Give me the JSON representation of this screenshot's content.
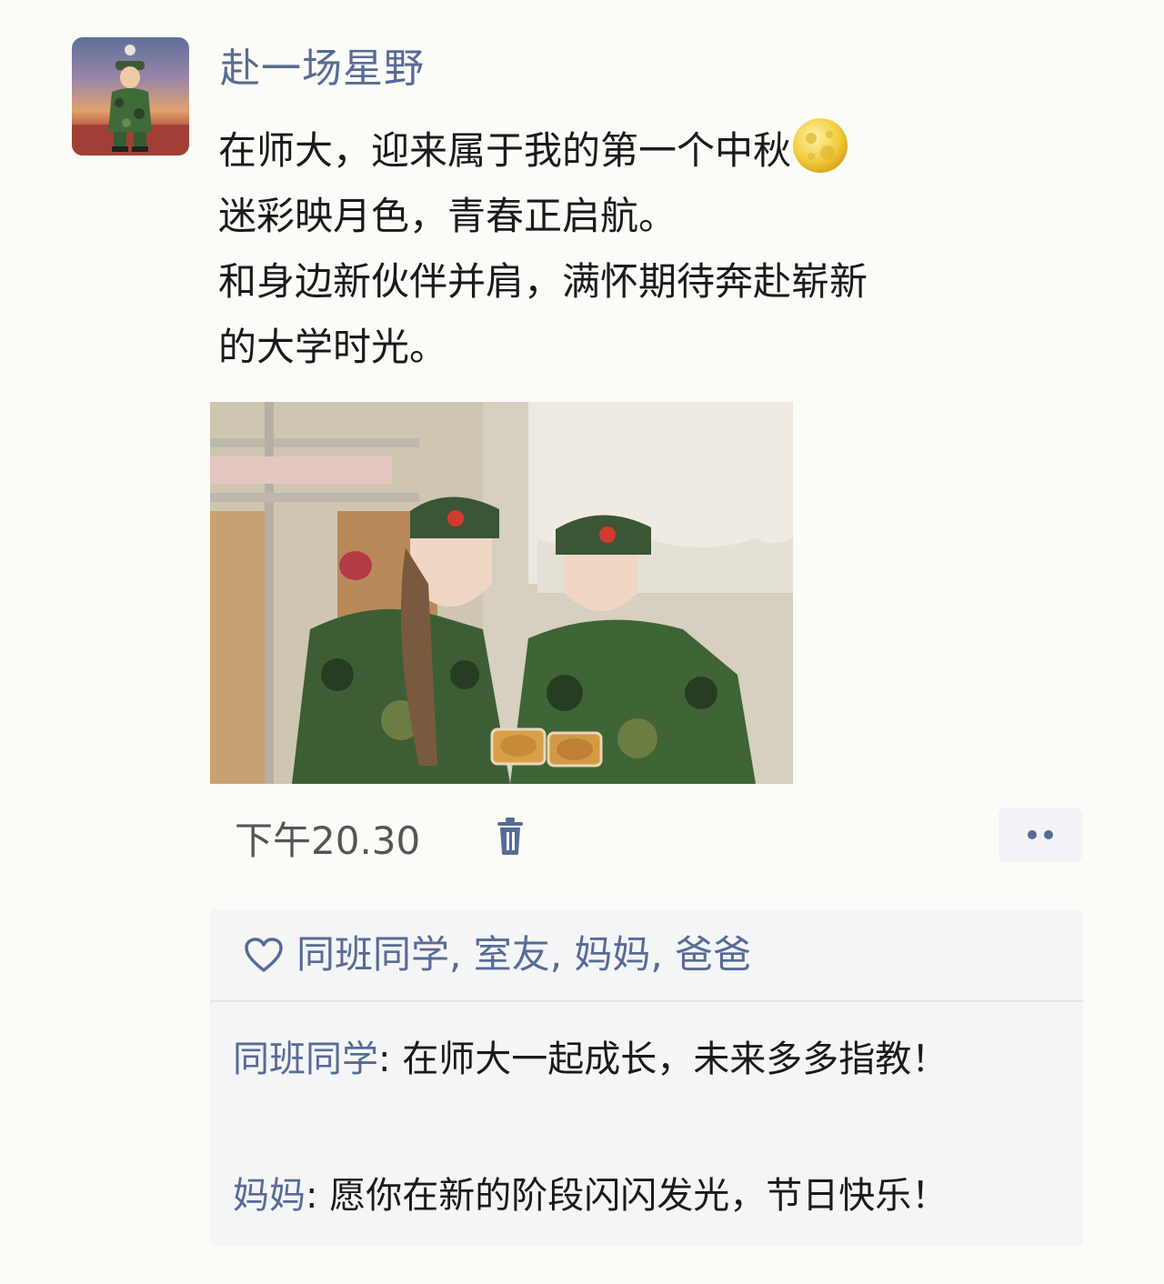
{
  "post": {
    "author": "赴一场星野",
    "text_lines": [
      "在师大，迎来属于我的第一个中秋",
      "迷彩映月色，青春正启航。",
      "和身边新伙伴并肩，满怀期待奔赴崭新",
      "的大学时光。"
    ],
    "emoji": "moon-icon",
    "time": "下午20.30"
  },
  "likes": {
    "names": "同班同学, 室友, 妈妈, 爸爸"
  },
  "comments": [
    {
      "author": "同班同学",
      "separator": ": ",
      "text": "在师大一起成长，未来多多指教！"
    },
    {
      "author": "妈妈",
      "separator": ": ",
      "text": "愿你在新的阶段闪闪发光，节日快乐！"
    }
  ],
  "colors": {
    "link": "#576b95",
    "background": "#fbfbf8",
    "panel": "#f4f5f7"
  }
}
